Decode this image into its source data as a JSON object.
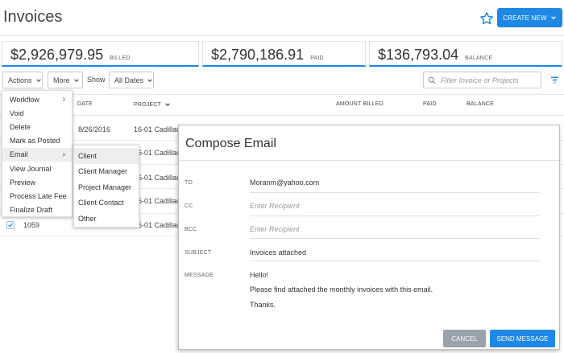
{
  "header": {
    "title": "Invoices",
    "create_label": "CREATE NEW"
  },
  "stats": [
    {
      "amount": "$2,926,979.95",
      "label": "BILLED"
    },
    {
      "amount": "$2,790,186.91",
      "label": "PAID"
    },
    {
      "amount": "$136,793.04",
      "label": "BALANCE"
    }
  ],
  "toolbar": {
    "actions_label": "Actions",
    "more_label": "More",
    "show_label": "Show",
    "dates_label": "All Dates",
    "search_placeholder": "Filter Invoice or Projects"
  },
  "table": {
    "headers": {
      "date": "DATE",
      "project": "PROJECT",
      "amount_billed": "AMOUNT BILLED",
      "paid": "PAID",
      "balance": "BALANCE"
    },
    "rows": [
      {
        "date": "8/26/2016",
        "project": "16-01 Cadillac"
      },
      {
        "project": "16-01 Cadillac"
      },
      {
        "project": "16-01 Cadillac"
      },
      {
        "project": "16-01 Cadillac"
      },
      {
        "number": "1059",
        "project": "16-01 Cadillac"
      }
    ]
  },
  "actions_menu": {
    "items": [
      "Workflow",
      "Void",
      "Delete",
      "Mark as Posted",
      "Email",
      "View Journal",
      "Preview",
      "Process Late Fee",
      "Finalize Draft"
    ]
  },
  "email_submenu": {
    "items": [
      "Client",
      "Client Manager",
      "Project Manager",
      "Client Contact",
      "Other"
    ]
  },
  "compose": {
    "title": "Compose Email",
    "to_label": "TO",
    "to_value": "Moranm@yahoo.com",
    "cc_label": "CC",
    "cc_placeholder": "Enter Recipient",
    "bcc_label": "BCC",
    "bcc_placeholder": "Enter Recipient",
    "subject_label": "SUBJECT",
    "subject_value": "Invoices attached",
    "message_label": "MESSAGE",
    "message_lines": [
      "Hello!",
      "Please find attached the monthly invoices with this email.",
      "Thanks."
    ],
    "cancel_label": "CANCEL",
    "send_label": "SEND MESSAGE"
  },
  "colors": {
    "accent": "#1e88e5",
    "cancel": "#9aa3ab"
  }
}
